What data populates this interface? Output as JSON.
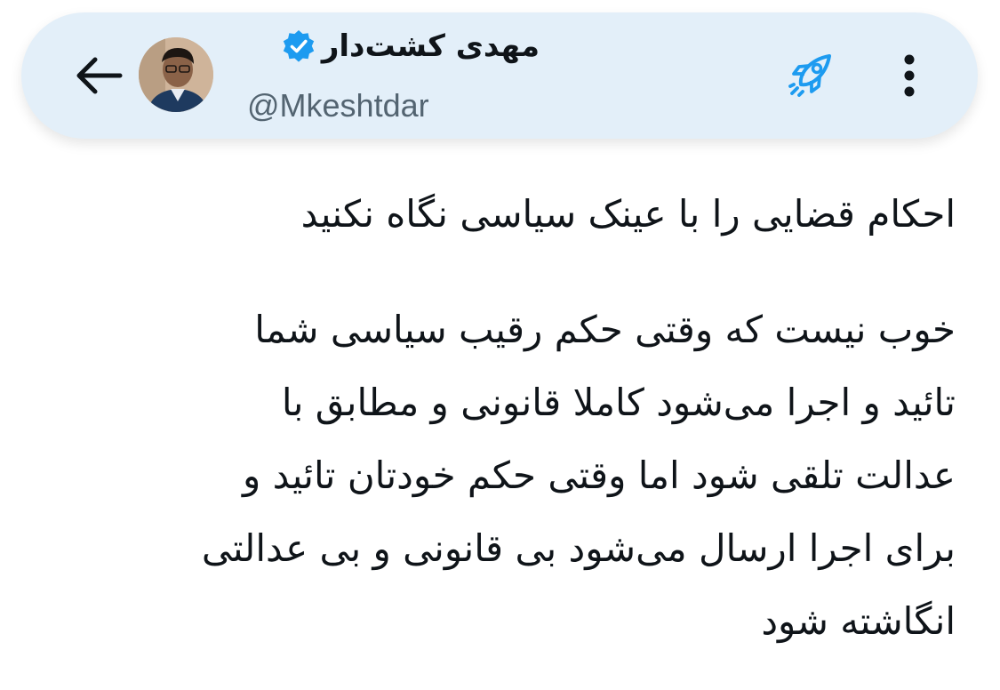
{
  "header": {
    "display_name": "مهدی کشت‌دار",
    "handle": "@Mkeshtdar",
    "verified": true,
    "back_icon": "arrow-left-icon",
    "boost_icon": "rocket-icon",
    "more_icon": "more-vertical-icon",
    "background_color": "#e3eff9",
    "accent_color": "#1d9bf0"
  },
  "tweet": {
    "title_line": "احکام قضایی را با عینک سیاسی نگاه نکنید",
    "lines": [
      "خوب نیست که وقتی حکم رقیب سیاسی شما",
      "تائید و اجرا می‌شود کاملا قانونی و مطابق با",
      "عدالت تلقی شود اما وقتی حکم خودتان تائید و",
      "برای اجرا ارسال می‌شود بی قانونی و بی عدالتی",
      "انگاشته شود"
    ]
  }
}
